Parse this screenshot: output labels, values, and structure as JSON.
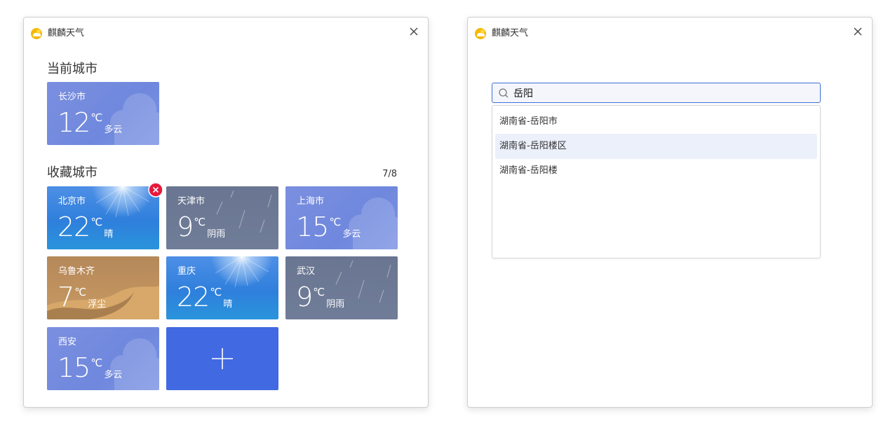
{
  "left_window": {
    "app_title": "麒麟天气",
    "current_section": "当前城市",
    "favorites_section": "收藏城市",
    "favorites_count": "7/8",
    "current_city": {
      "city": "长沙市",
      "temp": "12",
      "unit": "℃",
      "condition": "多云",
      "theme": "cloudy"
    },
    "favorites": [
      {
        "city": "北京市",
        "temp": "22",
        "unit": "℃",
        "condition": "晴",
        "theme": "sunny"
      },
      {
        "city": "天津市",
        "temp": "9",
        "unit": "℃",
        "condition": "阴雨",
        "theme": "overcast"
      },
      {
        "city": "上海市",
        "temp": "15",
        "unit": "℃",
        "condition": "多云",
        "theme": "cloudy"
      },
      {
        "city": "乌鲁木齐",
        "temp": "7",
        "unit": "℃",
        "condition": "浮尘",
        "theme": "dust"
      },
      {
        "city": "重庆",
        "temp": "22",
        "unit": "℃",
        "condition": "晴",
        "theme": "sunny"
      },
      {
        "city": "武汉",
        "temp": "9",
        "unit": "℃",
        "condition": "阴雨",
        "theme": "overcast"
      },
      {
        "city": "西安",
        "temp": "15",
        "unit": "℃",
        "condition": "多云",
        "theme": "cloudy"
      }
    ]
  },
  "right_window": {
    "app_title": "麒麟天气",
    "search": {
      "value": "岳阳"
    },
    "results": [
      "湖南省-岳阳市",
      "湖南省-岳阳楼区",
      "湖南省-岳阳楼"
    ]
  },
  "colors": {
    "accent": "#4169e1",
    "remove": "#e8193c",
    "highlight_row": "#ebf0fb"
  }
}
